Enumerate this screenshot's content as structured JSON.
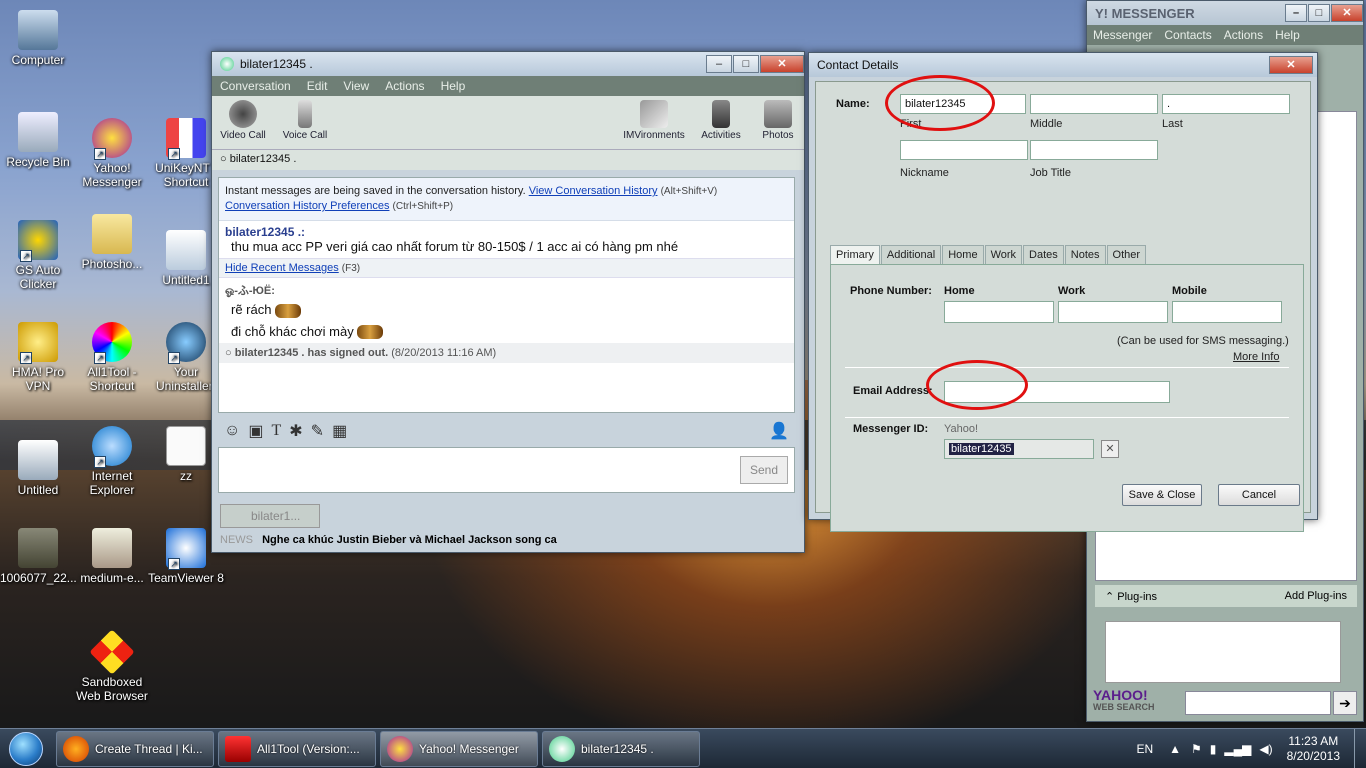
{
  "desktop": {
    "icons": [
      {
        "label": "Computer"
      },
      {
        "label": "Recycle Bin"
      },
      {
        "label": "Yahoo! Messenger"
      },
      {
        "label": "UniKeyNT - Shortcut"
      },
      {
        "label": "GS Auto Clicker"
      },
      {
        "label": "Photosho..."
      },
      {
        "label": "Untitled1"
      },
      {
        "label": "HMA! Pro VPN"
      },
      {
        "label": "All1Tool - Shortcut"
      },
      {
        "label": "Your Uninstaller!"
      },
      {
        "label": "Untitled"
      },
      {
        "label": "Internet Explorer"
      },
      {
        "label": "zz"
      },
      {
        "label": "1006077_22..."
      },
      {
        "label": "medium-e..."
      },
      {
        "label": "TeamViewer 8"
      },
      {
        "label": "Sandboxed Web Browser"
      }
    ]
  },
  "conversation": {
    "title": "bilater12345 .",
    "menu": [
      "Conversation",
      "Edit",
      "View",
      "Actions",
      "Help"
    ],
    "tools": [
      "Video Call",
      "Voice Call",
      "IMVironments",
      "Activities",
      "Photos"
    ],
    "status_name": "bilater12345 .",
    "history_notice": "Instant messages are being saved in the conversation history.",
    "view_history_link": "View Conversation History",
    "view_history_shortcut": "(Alt+Shift+V)",
    "history_prefs_link": "Conversation History Preferences",
    "history_prefs_shortcut": "(Ctrl+Shift+P)",
    "msg1_sender": "bilater12345 .:",
    "msg1_text": "thu mua acc PP veri giá cao nhất forum từ 80-150$ / 1 acc ai có hàng pm nhé",
    "hide_recent_link": "Hide Recent Messages",
    "hide_recent_shortcut": "(F3)",
    "msg2_sender": "ஓ-ふ-ЮЁ:",
    "msg2_line1": "rẽ rách",
    "msg2_line2": "đi chỗ khác chơi mày",
    "signout_name": "bilater12345 . has signed out.",
    "signout_time": "(8/20/2013 11:16 AM)",
    "send_label": "Send",
    "tab_label": "bilater1...",
    "news_prefix": "NEWS",
    "news_text": "Nghe ca khúc Justin Bieber và Michael Jackson song ca"
  },
  "contact_details": {
    "title": "Contact Details",
    "name_label": "Name:",
    "first_value": "bilater12345",
    "first_label": "First",
    "middle_value": "",
    "middle_label": "Middle",
    "last_value": ".",
    "last_label": "Last",
    "nickname_label": "Nickname",
    "jobtitle_label": "Job Title",
    "tabs": [
      "Primary",
      "Additional",
      "Home",
      "Work",
      "Dates",
      "Notes",
      "Other"
    ],
    "phone_label": "Phone Number:",
    "phone_home": "Home",
    "phone_work": "Work",
    "phone_mobile": "Mobile",
    "sms_note": "(Can be used for SMS messaging.)",
    "more_info": "More Info",
    "email_label": "Email Address:",
    "messenger_label": "Messenger ID:",
    "messenger_type": "Yahoo!",
    "messenger_value": "bilater12435",
    "save_close": "Save & Close",
    "cancel": "Cancel",
    "highlight_color": "#e01010"
  },
  "yahoo_main": {
    "title": "Y! MESSENGER",
    "menu": [
      "Messenger",
      "Contacts",
      "Actions",
      "Help"
    ],
    "plugins_label": "Plug-ins",
    "add_plugins": "Add Plug-ins",
    "web_search_logo": "YAHOO!",
    "web_search_label": "WEB SEARCH"
  },
  "taskbar": {
    "tasks": [
      "Create Thread | Ki...",
      "All1Tool (Version:...",
      "Yahoo! Messenger",
      "bilater12345 ."
    ],
    "lang": "EN",
    "time": "11:23 AM",
    "date": "8/20/2013"
  }
}
